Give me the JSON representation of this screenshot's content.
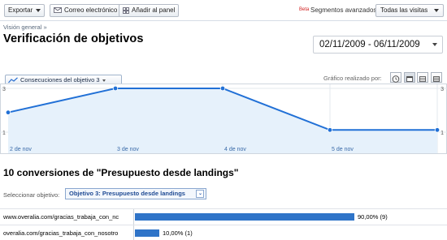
{
  "toolbar": {
    "export_label": "Exportar",
    "email_label": "Correo electrónico",
    "add_panel_label": "Añadir al panel",
    "beta_label": "Beta",
    "segments_label": "Segmentos avanzados:",
    "segments_value": "Todas las visitas"
  },
  "breadcrumb": "Visión general »",
  "page_title": "Verificación de objetivos",
  "date_range": "02/11/2009 - 06/11/2009",
  "graph": {
    "metric_selector": "Consecuciones del objetivo 3",
    "graph_by_label": "Gráfico realizado por:"
  },
  "chart_data": {
    "type": "area",
    "series": [
      {
        "name": "Consecuciones del objetivo 3",
        "values": [
          1.9,
          3,
          3,
          1.1,
          1.1
        ]
      }
    ],
    "x_tick_labels": [
      "2 de nov",
      "3 de nov",
      "4 de nov",
      "5 de nov"
    ],
    "y_tick_labels_left": [
      "3",
      "1"
    ],
    "y_tick_labels_right": [
      "3",
      "1"
    ],
    "ylim": [
      1,
      3
    ],
    "grid": true,
    "colors": {
      "line": "#2170d6",
      "fill": "#e6f1fb"
    }
  },
  "conversions": {
    "title": "10 conversiones de \"Presupuesto desde landings\"",
    "select_label": "Seleccionar objetivo:",
    "select_value": "Objetivo 3: Presupuesto desde landings",
    "rows": [
      {
        "url": "www.overalia.com/gracias_trabaja_con_nc",
        "percent": 90,
        "label": "90,00% (9)"
      },
      {
        "url": "overalia.com/gracias_trabaja_con_nosotro",
        "percent": 10,
        "label": "10,00% (1)"
      }
    ]
  }
}
